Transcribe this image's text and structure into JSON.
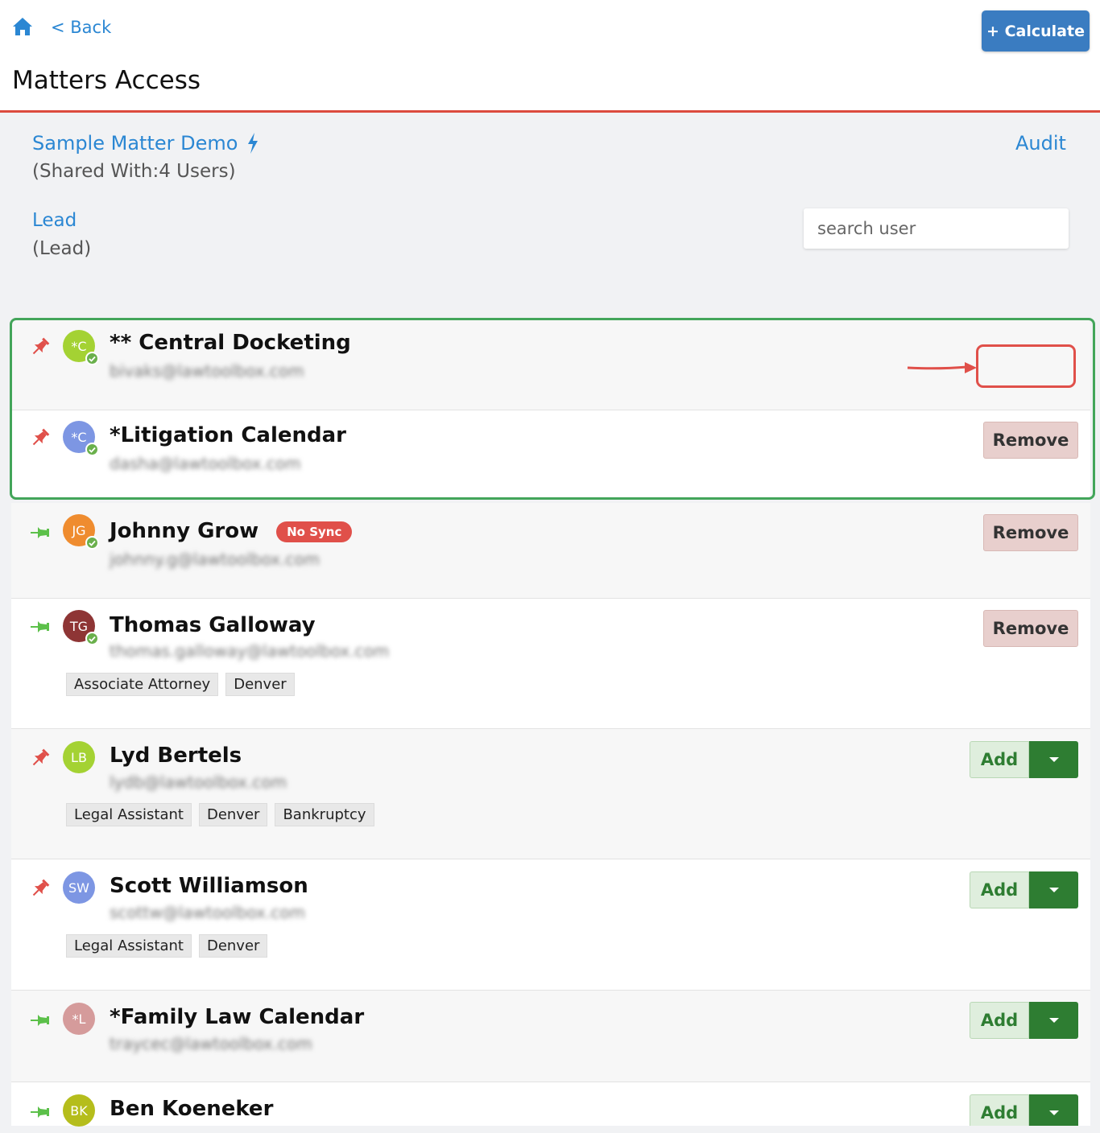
{
  "header": {
    "back_label": "< Back",
    "calculate_label": "+ Calculate",
    "page_title": "Matters Access",
    "accent_color": "#dc4b3e"
  },
  "matter": {
    "name": "Sample Matter Demo",
    "shared_with": "(Shared With:4 Users)",
    "audit_label": "Audit",
    "lead_label": "Lead",
    "lead_sub": "(Lead)"
  },
  "search": {
    "placeholder": "search user"
  },
  "users": [
    {
      "initials": "*C",
      "name": "** Central Docketing",
      "email": "bivaks@lawtoolbox.com",
      "pinned": true,
      "synced": true,
      "action": "highlighted"
    },
    {
      "initials": "*C",
      "name": "*Litigation Calendar",
      "email": "dasha@lawtoolbox.com",
      "pinned": true,
      "synced": true,
      "action": "Remove"
    },
    {
      "initials": "JG",
      "name": "Johnny Grow",
      "badge": "No Sync",
      "email": "johnny.g@lawtoolbox.com",
      "pinned": false,
      "synced": true,
      "action": "Remove"
    },
    {
      "initials": "TG",
      "name": "Thomas Galloway",
      "email": "thomas.galloway@lawtoolbox.com",
      "tags": [
        "Associate Attorney",
        "Denver"
      ],
      "pinned": false,
      "synced": true,
      "action": "Remove"
    },
    {
      "initials": "LB",
      "name": "Lyd Bertels",
      "email": "lydb@lawtoolbox.com",
      "tags": [
        "Legal Assistant",
        "Denver",
        "Bankruptcy"
      ],
      "pinned": true,
      "action": "Add"
    },
    {
      "initials": "SW",
      "name": "Scott Williamson",
      "email": "scottw@lawtoolbox.com",
      "tags": [
        "Legal Assistant",
        "Denver"
      ],
      "pinned": true,
      "action": "Add"
    },
    {
      "initials": "*L",
      "name": "*Family Law Calendar",
      "email": "traycec@lawtoolbox.com",
      "pinned": false,
      "action": "Add"
    },
    {
      "initials": "BK",
      "name": "Ben Koeneker",
      "pinned": false,
      "action": "Add"
    }
  ],
  "buttons": {
    "remove": "Remove",
    "add": "Add"
  },
  "colors": {
    "link": "#2b87d3",
    "pin_active": "#e0504a",
    "pin_inactive": "#5cc04a",
    "add_dark": "#2e7d32",
    "highlight_green": "#43a55a"
  },
  "icons": [
    "home-icon",
    "bolt-icon",
    "pin-icon",
    "check-icon",
    "caret-down-icon",
    "arrow-icon"
  ]
}
